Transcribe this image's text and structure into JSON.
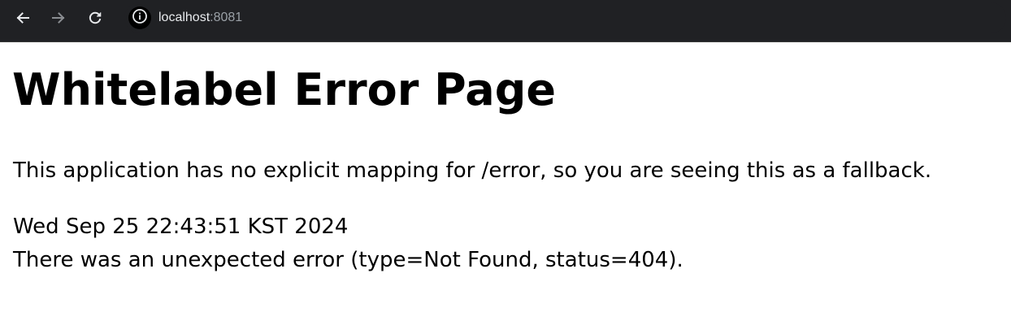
{
  "browser": {
    "url_host": "localhost",
    "url_port": ":8081",
    "icons": {
      "back": "arrow-left-icon",
      "forward": "arrow-right-icon",
      "reload": "reload-icon",
      "site_info": "info-icon"
    }
  },
  "page": {
    "title": "Whitelabel Error Page",
    "description": "This application has no explicit mapping for /error, so you are seeing this as a fallback.",
    "timestamp": "Wed Sep 25 22:43:51 KST 2024",
    "error_message": "There was an unexpected error (type=Not Found, status=404)."
  }
}
